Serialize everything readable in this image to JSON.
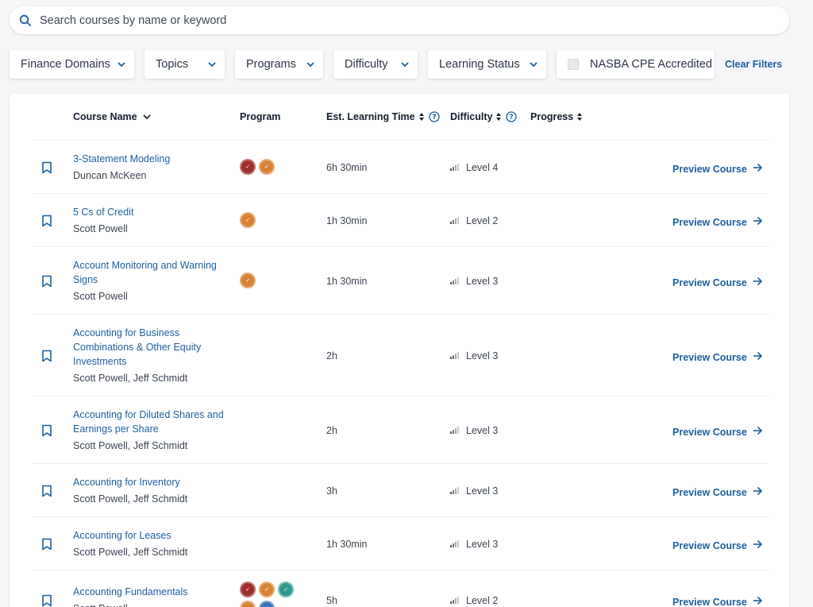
{
  "search": {
    "placeholder": "Search courses by name or keyword",
    "value": ""
  },
  "filters": [
    {
      "label": "Finance Domains"
    },
    {
      "label": "Topics"
    },
    {
      "label": "Programs"
    },
    {
      "label": "Difficulty"
    },
    {
      "label": "Learning Status"
    }
  ],
  "nasba": {
    "label": "NASBA CPE Accredited",
    "checked": false
  },
  "clear_filters_label": "Clear Filters",
  "table": {
    "headers": {
      "course_name": "Course Name",
      "program": "Program",
      "time": "Est. Learning Time",
      "difficulty": "Difficulty",
      "progress": "Progress"
    }
  },
  "preview_label": "Preview Course",
  "badge_colors": {
    "red": "#9e2f2c",
    "orange": "#d98234",
    "teal": "#2e9a8e",
    "blue": "#3d72b8"
  },
  "courses": [
    {
      "title": "3-Statement Modeling",
      "author": "Duncan McKeen",
      "time": "6h 30min",
      "difficulty": "Level 4",
      "programs": [
        "red",
        "orange"
      ]
    },
    {
      "title": "5 Cs of Credit",
      "author": "Scott Powell",
      "time": "1h 30min",
      "difficulty": "Level 2",
      "programs": [
        "orange"
      ]
    },
    {
      "title": "Account Monitoring and Warning Signs",
      "author": "Scott Powell",
      "time": "1h 30min",
      "difficulty": "Level 3",
      "programs": [
        "orange"
      ]
    },
    {
      "title": "Accounting for Business Combinations & Other Equity Investments",
      "author": "Scott Powell, Jeff Schmidt",
      "time": "2h",
      "difficulty": "Level 3",
      "programs": []
    },
    {
      "title": "Accounting for Diluted Shares and Earnings per Share",
      "author": "Scott Powell, Jeff Schmidt",
      "time": "2h",
      "difficulty": "Level 3",
      "programs": []
    },
    {
      "title": "Accounting for Inventory",
      "author": "Scott Powell, Jeff Schmidt",
      "time": "3h",
      "difficulty": "Level 3",
      "programs": []
    },
    {
      "title": "Accounting for Leases",
      "author": "Scott Powell, Jeff Schmidt",
      "time": "1h 30min",
      "difficulty": "Level 3",
      "programs": []
    },
    {
      "title": "Accounting Fundamentals",
      "author": "Scott Powell",
      "time": "5h",
      "difficulty": "Level 2",
      "programs": [
        "red",
        "orange",
        "teal",
        "orange",
        "blue"
      ]
    }
  ]
}
